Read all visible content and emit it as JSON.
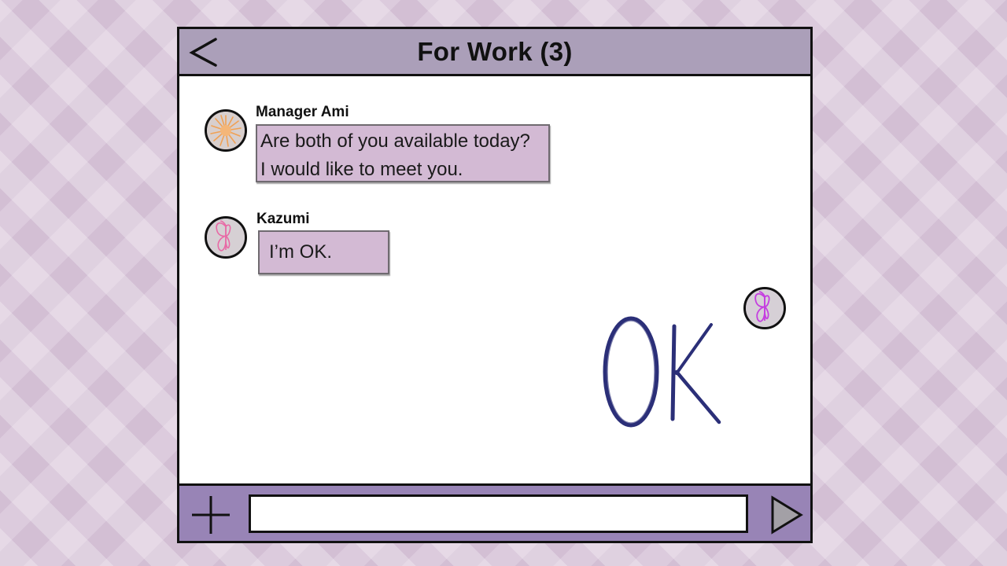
{
  "chat": {
    "title": "For Work (3)",
    "messages": [
      {
        "sender": "Manager Ami",
        "avatar_icon": "orange-flower-avatar-icon",
        "lines": [
          "Are both of you available today?",
          "I would like to meet you."
        ]
      },
      {
        "sender": "Kazumi",
        "avatar_icon": "pink-butterfly-avatar-icon",
        "lines": [
          "I’m OK."
        ]
      },
      {
        "sender": "",
        "avatar_icon": "purple-butterfly-avatar-icon",
        "content": "OK"
      }
    ]
  },
  "composer": {
    "input_value": "",
    "add_icon": "plus-icon",
    "send_icon": "send-triangle-icon"
  },
  "icons": {
    "back": "back-chevron-icon"
  },
  "colors": {
    "header": "#ab9fb9",
    "composer_bar": "#9884b6",
    "bubble": "#d3bad4",
    "handwriting_ink": "#2b2f78",
    "background": "#dccbdd"
  }
}
